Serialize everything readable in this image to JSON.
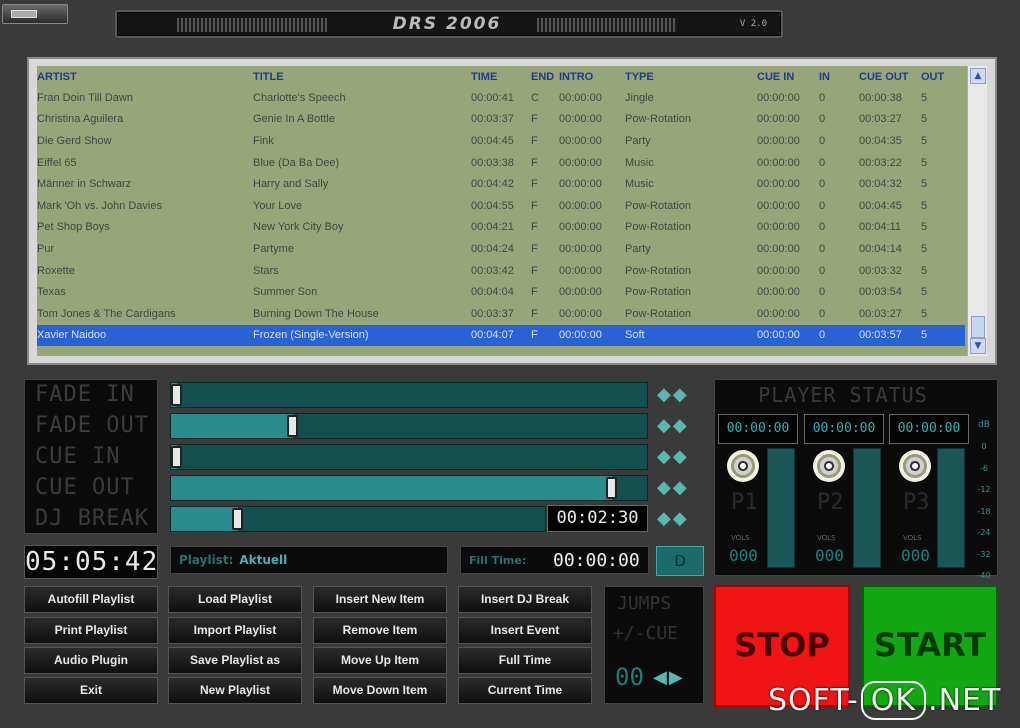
{
  "app": {
    "title": "DRS 2006",
    "version": "V 2.0"
  },
  "playlist": {
    "headers": [
      "ARTIST",
      "TITLE",
      "TIME",
      "END",
      "INTRO",
      "TYPE",
      "CUE IN",
      "IN",
      "CUE OUT",
      "OUT"
    ],
    "rows": [
      [
        "Fran Doin Till Dawn",
        "Charlotte's Speech",
        "00:00:41",
        "C",
        "00:00:00",
        "Jingle",
        "00:00:00",
        "0",
        "00:00:38",
        "5"
      ],
      [
        "Christina Aguilera",
        "Genie In A Bottle",
        "00:03:37",
        "F",
        "00:00:00",
        "Pow-Rotation",
        "00:00:00",
        "0",
        "00:03:27",
        "5"
      ],
      [
        "Die Gerd Show",
        "Fink",
        "00:04:45",
        "F",
        "00:00:00",
        "Party",
        "00:00:00",
        "0",
        "00:04:35",
        "5"
      ],
      [
        "Eiffel 65",
        "Blue (Da Ba Dee)",
        "00:03:38",
        "F",
        "00:00:00",
        "Music",
        "00:00:00",
        "0",
        "00:03:22",
        "5"
      ],
      [
        "Männer in Schwarz",
        "Harry and Sally",
        "00:04:42",
        "F",
        "00:00:00",
        "Music",
        "00:00:00",
        "0",
        "00:04:32",
        "5"
      ],
      [
        "Mark 'Oh vs. John Davies",
        "Your Love",
        "00:04:55",
        "F",
        "00:00:00",
        "Pow-Rotation",
        "00:00:00",
        "0",
        "00:04:45",
        "5"
      ],
      [
        "Pet Shop Boys",
        "New York City Boy",
        "00:04:21",
        "F",
        "00:00:00",
        "Pow-Rotation",
        "00:00:00",
        "0",
        "00:04:11",
        "5"
      ],
      [
        "Pur",
        "Partyme",
        "00:04:24",
        "F",
        "00:00:00",
        "Party",
        "00:00:00",
        "0",
        "00:04:14",
        "5"
      ],
      [
        "Roxette",
        "Stars",
        "00:03:42",
        "F",
        "00:00:00",
        "Pow-Rotation",
        "00:00:00",
        "0",
        "00:03:32",
        "5"
      ],
      [
        "Texas",
        "Summer Son",
        "00:04:04",
        "F",
        "00:00:00",
        "Pow-Rotation",
        "00:00:00",
        "0",
        "00:03:54",
        "5"
      ],
      [
        "Tom Jones & The Cardigans",
        "Burning Down The House",
        "00:03:37",
        "F",
        "00:00:00",
        "Pow-Rotation",
        "00:00:00",
        "0",
        "00:03:27",
        "5"
      ],
      [
        "Xavier Naidoo",
        "Frozen (Single-Version)",
        "00:04:07",
        "F",
        "00:00:00",
        "Soft",
        "00:00:00",
        "0",
        "00:03:57",
        "5"
      ]
    ],
    "selected_row": 11
  },
  "faders": {
    "fade_in": {
      "label": "FADE IN",
      "value": 0.0
    },
    "fade_out": {
      "label": "FADE OUT",
      "value": 0.25
    },
    "cue_in": {
      "label": "CUE IN",
      "value": 0.0
    },
    "cue_out": {
      "label": "CUE OUT",
      "value": 0.94
    },
    "dj_break": {
      "label": "DJ BREAK",
      "value": 0.17,
      "time": "00:02:30"
    }
  },
  "player_status": {
    "title": "PLAYER STATUS",
    "db_label": "dB",
    "db_scale": [
      "0",
      "-6",
      "-12",
      "-18",
      "-24",
      "-32",
      "-40"
    ],
    "players": [
      {
        "name": "P1",
        "time": "00:00:00",
        "vol_label": "VOLS",
        "vol_digits": "000",
        "level": 1.0
      },
      {
        "name": "P2",
        "time": "00:00:00",
        "vol_label": "VOLS",
        "vol_digits": "000",
        "level": 1.0
      },
      {
        "name": "P3",
        "time": "00:00:00",
        "vol_label": "VOLS",
        "vol_digits": "000",
        "level": 1.0
      }
    ]
  },
  "clock": "05:05:42",
  "playlist_label": {
    "key": "Playlist:",
    "value": "Aktuell"
  },
  "fill_time": {
    "label": "Fill Time:",
    "value": "00:00:00"
  },
  "d_button": "D",
  "commands": [
    [
      "Autofill Playlist",
      "Load Playlist",
      "Insert New Item",
      "Insert DJ Break"
    ],
    [
      "Print Playlist",
      "Import Playlist",
      "Remove Item",
      "Insert Event"
    ],
    [
      "Audio Plugin",
      "Save Playlist as",
      "Move Up Item",
      "Full Time"
    ],
    [
      "Exit",
      "New Playlist",
      "Move Down Item",
      "Current Time"
    ]
  ],
  "jumps": {
    "title": "JUMPS",
    "subtitle": "+/-CUE",
    "digits": "00"
  },
  "stop_label": "STOP",
  "start_label": "START",
  "watermark": {
    "left": "SOFT-",
    "ok": "OK",
    "right": ".NET"
  },
  "colors": {
    "stop": "#f01414",
    "start": "#13a813",
    "accent": "#2a8c8c",
    "selection": "#2a62d6"
  }
}
